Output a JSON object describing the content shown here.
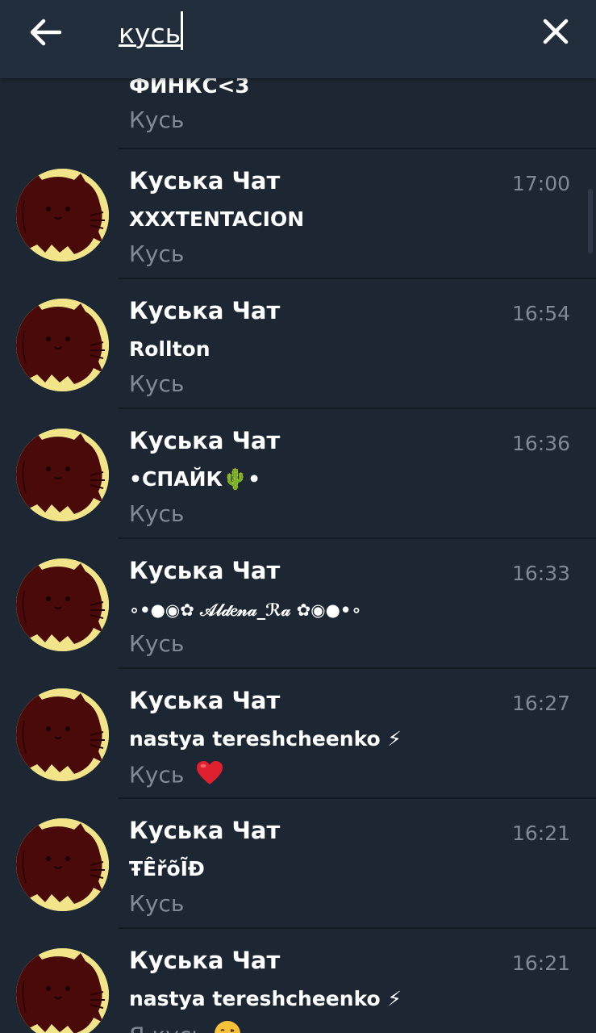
{
  "search": {
    "query": "кусь"
  },
  "colors": {
    "header_bg": "#232e3c",
    "list_bg": "#1d2733",
    "divider": "#121a23",
    "secondary_text": "#818a94",
    "avatar_bg": "#f2e589",
    "avatar_cat": "#4a0a0a"
  },
  "results": [
    {
      "name": "",
      "message": "ФИНКС<3",
      "sub": "Кусь",
      "time": "",
      "sub_emoji": ""
    },
    {
      "name": "Куська Чат",
      "message": "XXXTENTACION",
      "sub": "Кусь",
      "time": "17:00",
      "sub_emoji": ""
    },
    {
      "name": "Куська Чат",
      "message": "Rollton",
      "sub": "Кусь",
      "time": "16:54",
      "sub_emoji": ""
    },
    {
      "name": "Куська Чат",
      "message": "•СПАЙК🌵•",
      "sub": "Кусь",
      "time": "16:36",
      "sub_emoji": ""
    },
    {
      "name": "Куська Чат",
      "message": "∘•●◉✿ 𝒜𝓁𝒹𝑒𝓃𝒶_ℛ𝒶 ✿◉●•∘",
      "sub": "Кусь",
      "time": "16:33",
      "sub_emoji": ""
    },
    {
      "name": "Куська Чат",
      "message": "nastya tereshcheenko ⚡",
      "sub": "Кусь",
      "time": "16:27",
      "sub_emoji": "heart-emoji"
    },
    {
      "name": "Куська Чат",
      "message": "ŦÊřõĨĐ",
      "sub": "Кусь",
      "time": "16:21",
      "sub_emoji": ""
    },
    {
      "name": "Куська Чат",
      "message": "nastya tereshcheenko ⚡",
      "sub": "Я кусь",
      "time": "16:21",
      "sub_emoji": "kiss-emoji"
    }
  ]
}
